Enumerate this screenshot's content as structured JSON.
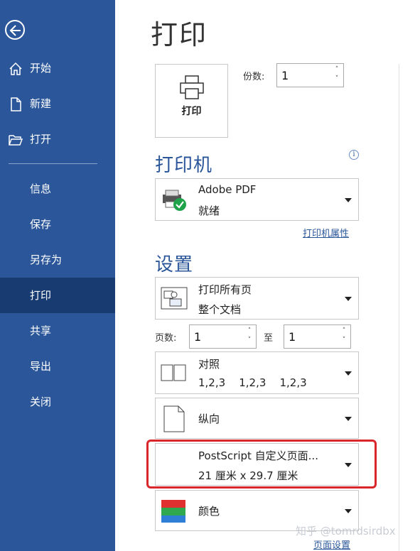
{
  "sidebar": {
    "items": [
      {
        "label": "开始",
        "icon": "home-icon"
      },
      {
        "label": "新建",
        "icon": "new-doc-icon"
      },
      {
        "label": "打开",
        "icon": "folder-open-icon"
      },
      {
        "label": "信息"
      },
      {
        "label": "保存"
      },
      {
        "label": "另存为"
      },
      {
        "label": "打印",
        "active": true
      },
      {
        "label": "共享"
      },
      {
        "label": "导出"
      },
      {
        "label": "关闭"
      }
    ],
    "bg_color": "#2b579a",
    "active_color": "#183c71"
  },
  "main": {
    "title": "打印",
    "print_button_label": "打印",
    "copies_label": "份数:",
    "copies_value": "1"
  },
  "printer": {
    "heading": "打印机",
    "name": "Adobe PDF",
    "status": "就绪",
    "properties_link": "打印机属性"
  },
  "settings": {
    "heading": "设置",
    "range": {
      "title": "打印所有页",
      "subtitle": "整个文档"
    },
    "pages_label": "页数:",
    "pages_from": "1",
    "to_label": "至",
    "pages_to": "1",
    "collate": {
      "title": "对照",
      "subtitle": "1,2,3    1,2,3    1,2,3"
    },
    "orientation": {
      "title": "纵向"
    },
    "paper": {
      "title": "PostScript 自定义页面...",
      "subtitle": "21 厘米 x 29.7 厘米"
    },
    "color": {
      "title": "颜色"
    },
    "page_setup_link": "页面设置"
  },
  "watermark": "知乎 @tomrdsirdbx"
}
